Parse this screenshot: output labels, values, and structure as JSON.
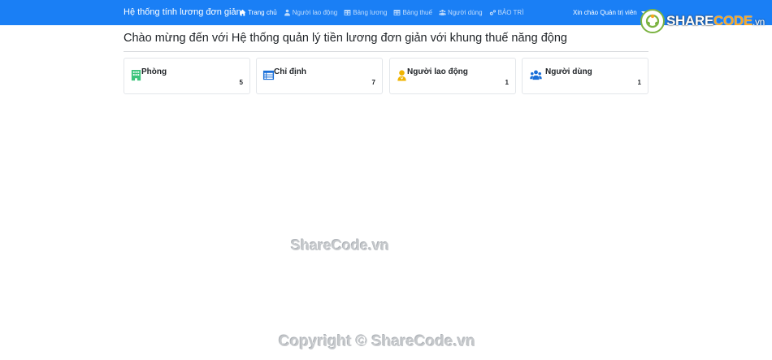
{
  "navbar": {
    "brand": "Hệ thống tính lương đơn giản",
    "items": [
      {
        "label": "Trang chủ",
        "icon": "home-icon",
        "active": true
      },
      {
        "label": "Người lao động",
        "icon": "user-icon",
        "active": false
      },
      {
        "label": "Bảng lương",
        "icon": "table-icon",
        "active": false
      },
      {
        "label": "Bảng thuế",
        "icon": "table-icon",
        "active": false
      },
      {
        "label": "Người dùng",
        "icon": "users-icon",
        "active": false
      },
      {
        "label": "BẢO TRÌ",
        "icon": "gears-icon",
        "active": false
      }
    ],
    "greeting": "Xin chào Quản trị viên"
  },
  "logo": {
    "part1": "SHARE",
    "part2": "CODE",
    "part3": ".vn"
  },
  "page": {
    "title": "Chào mừng đến với Hệ thống quản lý tiền lương đơn giản với khung thuế năng động"
  },
  "cards": [
    {
      "label": "Phòng",
      "count": "5",
      "icon": "building-icon",
      "color": "#3cc47c"
    },
    {
      "label": "Chỉ định",
      "count": "7",
      "icon": "list-table-icon",
      "color": "#1a6fd8"
    },
    {
      "label": "Người lao động",
      "count": "1",
      "icon": "worker-icon",
      "color": "#f0b400"
    },
    {
      "label": "Người dùng",
      "count": "1",
      "icon": "users-icon",
      "color": "#1a6fd8"
    }
  ],
  "watermarks": {
    "center": "ShareCode.vn",
    "bottom": "Copyright © ShareCode.vn"
  },
  "colors": {
    "navbar": "#1a7ff5",
    "text": "#212529"
  }
}
